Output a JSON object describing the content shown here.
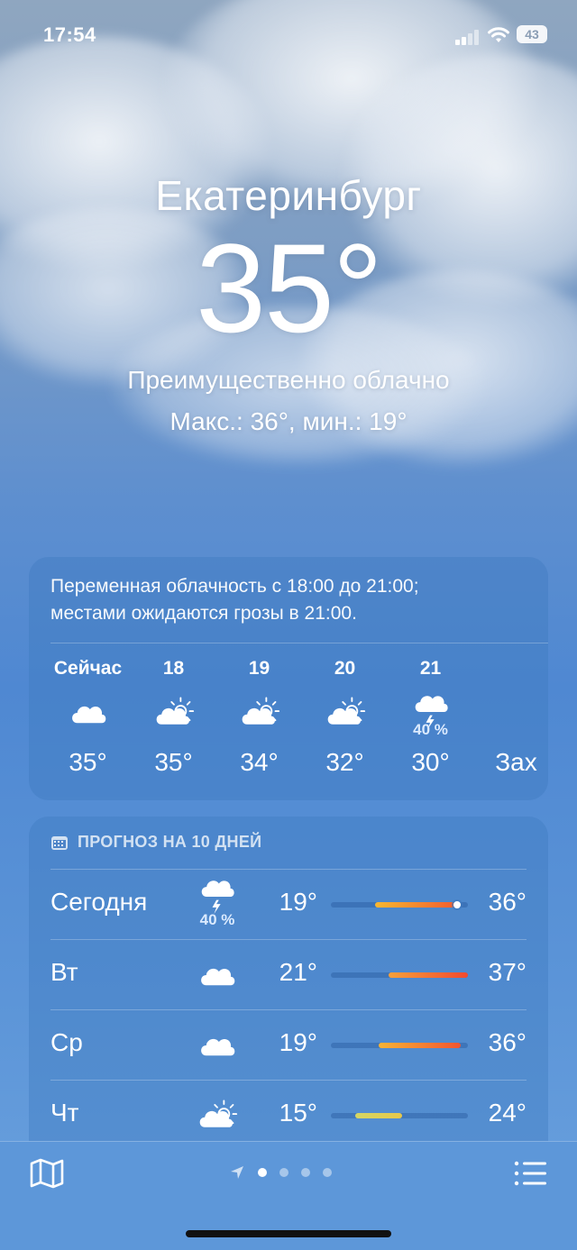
{
  "status_bar": {
    "time": "17:54",
    "battery": "43"
  },
  "current": {
    "city": "Екатеринбург",
    "temperature": "35°",
    "condition": "Преимущественно облачно",
    "high_low": "Макс.: 36°, мин.: 19°"
  },
  "hourly": {
    "summary_line1": "Переменная облачность с 18:00 до 21:00;",
    "summary_line2": "местами ожидаются грозы в 21:00.",
    "items": [
      {
        "label": "Сейчас",
        "icon": "cloud-icon",
        "precip": "",
        "temp": "35°"
      },
      {
        "label": "18",
        "icon": "partly-sunny-icon",
        "precip": "",
        "temp": "35°"
      },
      {
        "label": "19",
        "icon": "partly-sunny-icon",
        "precip": "",
        "temp": "34°"
      },
      {
        "label": "20",
        "icon": "partly-sunny-icon",
        "precip": "",
        "temp": "32°"
      },
      {
        "label": "21",
        "icon": "thunderstorm-icon",
        "precip": "40 %",
        "temp": "30°"
      },
      {
        "label": "",
        "icon": "",
        "precip": "",
        "temp": "Зах"
      }
    ]
  },
  "daily": {
    "header": "ПРОГНОЗ НА 10 ДНЕЙ",
    "rows": [
      {
        "day": "Сегодня",
        "icon": "thunderstorm-icon",
        "precip": "40 %",
        "low": "19°",
        "high": "36°",
        "bar_start": 0.32,
        "bar_end": 0.9,
        "current_marker": 0.92,
        "colors": [
          "#f7b731",
          "#f2602f"
        ]
      },
      {
        "day": "Вт",
        "icon": "cloud-icon",
        "precip": "",
        "low": "21°",
        "high": "37°",
        "bar_start": 0.42,
        "bar_end": 1.0,
        "colors": [
          "#f7a03a",
          "#f24a2f"
        ]
      },
      {
        "day": "Ср",
        "icon": "cloud-icon",
        "precip": "",
        "low": "19°",
        "high": "36°",
        "bar_start": 0.35,
        "bar_end": 0.95,
        "colors": [
          "#f8b334",
          "#f25530"
        ]
      },
      {
        "day": "Чт",
        "icon": "partly-sunny-icon",
        "precip": "",
        "low": "15°",
        "high": "24°",
        "bar_start": 0.18,
        "bar_end": 0.52,
        "colors": [
          "#d4d665",
          "#e8c84a"
        ]
      }
    ]
  },
  "tab_bar": {
    "pages": 4,
    "active_page": 1
  }
}
